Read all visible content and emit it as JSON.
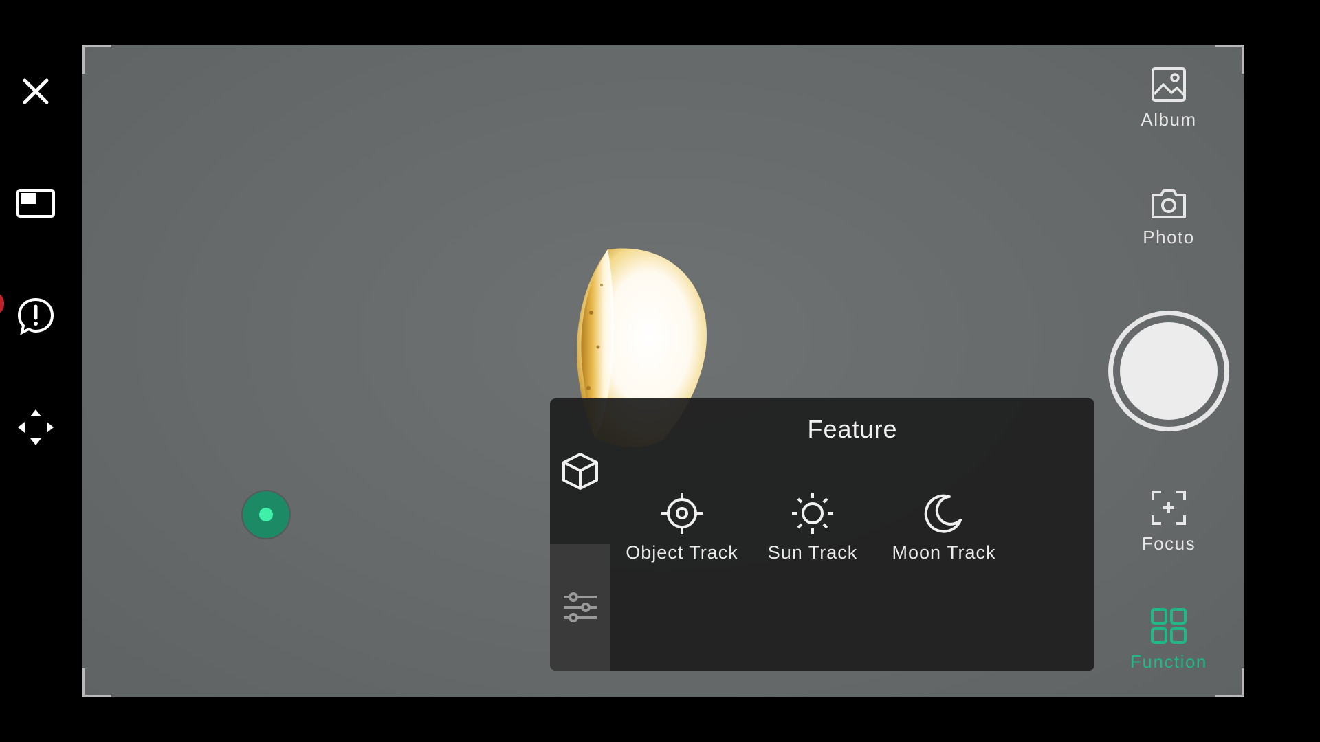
{
  "left_toolbar": {
    "buttons": [
      {
        "name": "close-icon"
      },
      {
        "name": "picture-in-picture-icon"
      },
      {
        "name": "feedback-alert-icon"
      },
      {
        "name": "move-arrows-icon"
      }
    ]
  },
  "right_toolbar": {
    "album_label": "Album",
    "photo_label": "Photo",
    "focus_label": "Focus",
    "function_label": "Function",
    "active_color": "#21b787"
  },
  "feature_panel": {
    "title": "Feature",
    "items": [
      {
        "label": "Object Track",
        "icon": "target-icon"
      },
      {
        "label": "Sun Track",
        "icon": "sun-icon"
      },
      {
        "label": "Moon Track",
        "icon": "moon-icon"
      }
    ],
    "side_tabs": [
      "cube-icon",
      "sliders-icon"
    ]
  },
  "viewfinder": {
    "subject": "moon",
    "joystick_color": "#1c8a64"
  }
}
